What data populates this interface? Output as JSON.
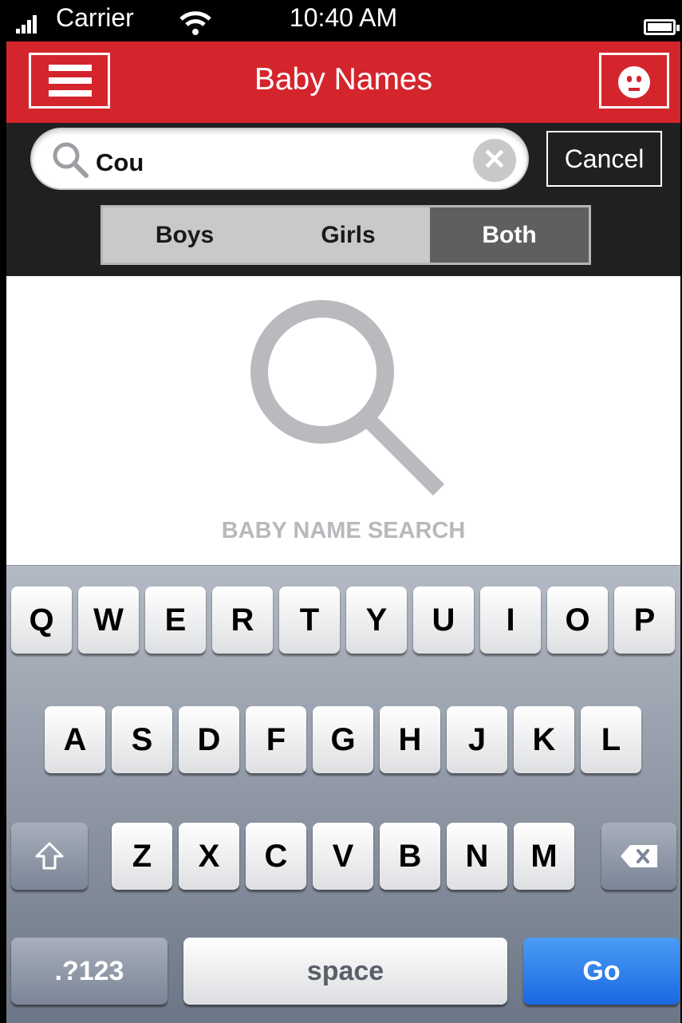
{
  "status_bar": {
    "carrier": "Carrier",
    "time": "10:40 AM",
    "icons": [
      "signal-icon",
      "wifi-icon",
      "battery-icon"
    ]
  },
  "nav_bar": {
    "title": "Baby Names",
    "menu_icon": "hamburger-menu-icon",
    "profile_icon": "face-icon",
    "background_color": "#d4252c"
  },
  "search": {
    "query": "Cou",
    "search_icon": "search-icon",
    "clear_icon": "clear-icon",
    "clear_glyph": "✕",
    "cancel_label": "Cancel"
  },
  "gender_filter": {
    "options": [
      "Boys",
      "Girls",
      "Both"
    ],
    "selected": "Both"
  },
  "empty_state": {
    "icon": "search-icon",
    "label": "BABY NAME SEARCH"
  },
  "keyboard": {
    "row1": [
      "Q",
      "W",
      "E",
      "R",
      "T",
      "Y",
      "U",
      "I",
      "O",
      "P"
    ],
    "row2": [
      "A",
      "S",
      "D",
      "F",
      "G",
      "H",
      "J",
      "K",
      "L"
    ],
    "row3": [
      "Z",
      "X",
      "C",
      "V",
      "B",
      "N",
      "M"
    ],
    "shift_icon": "shift-icon",
    "delete_icon": "backspace-icon",
    "numbers_label": ".?123",
    "space_label": "space",
    "go_label": "Go",
    "go_color": "#1a68e0"
  }
}
